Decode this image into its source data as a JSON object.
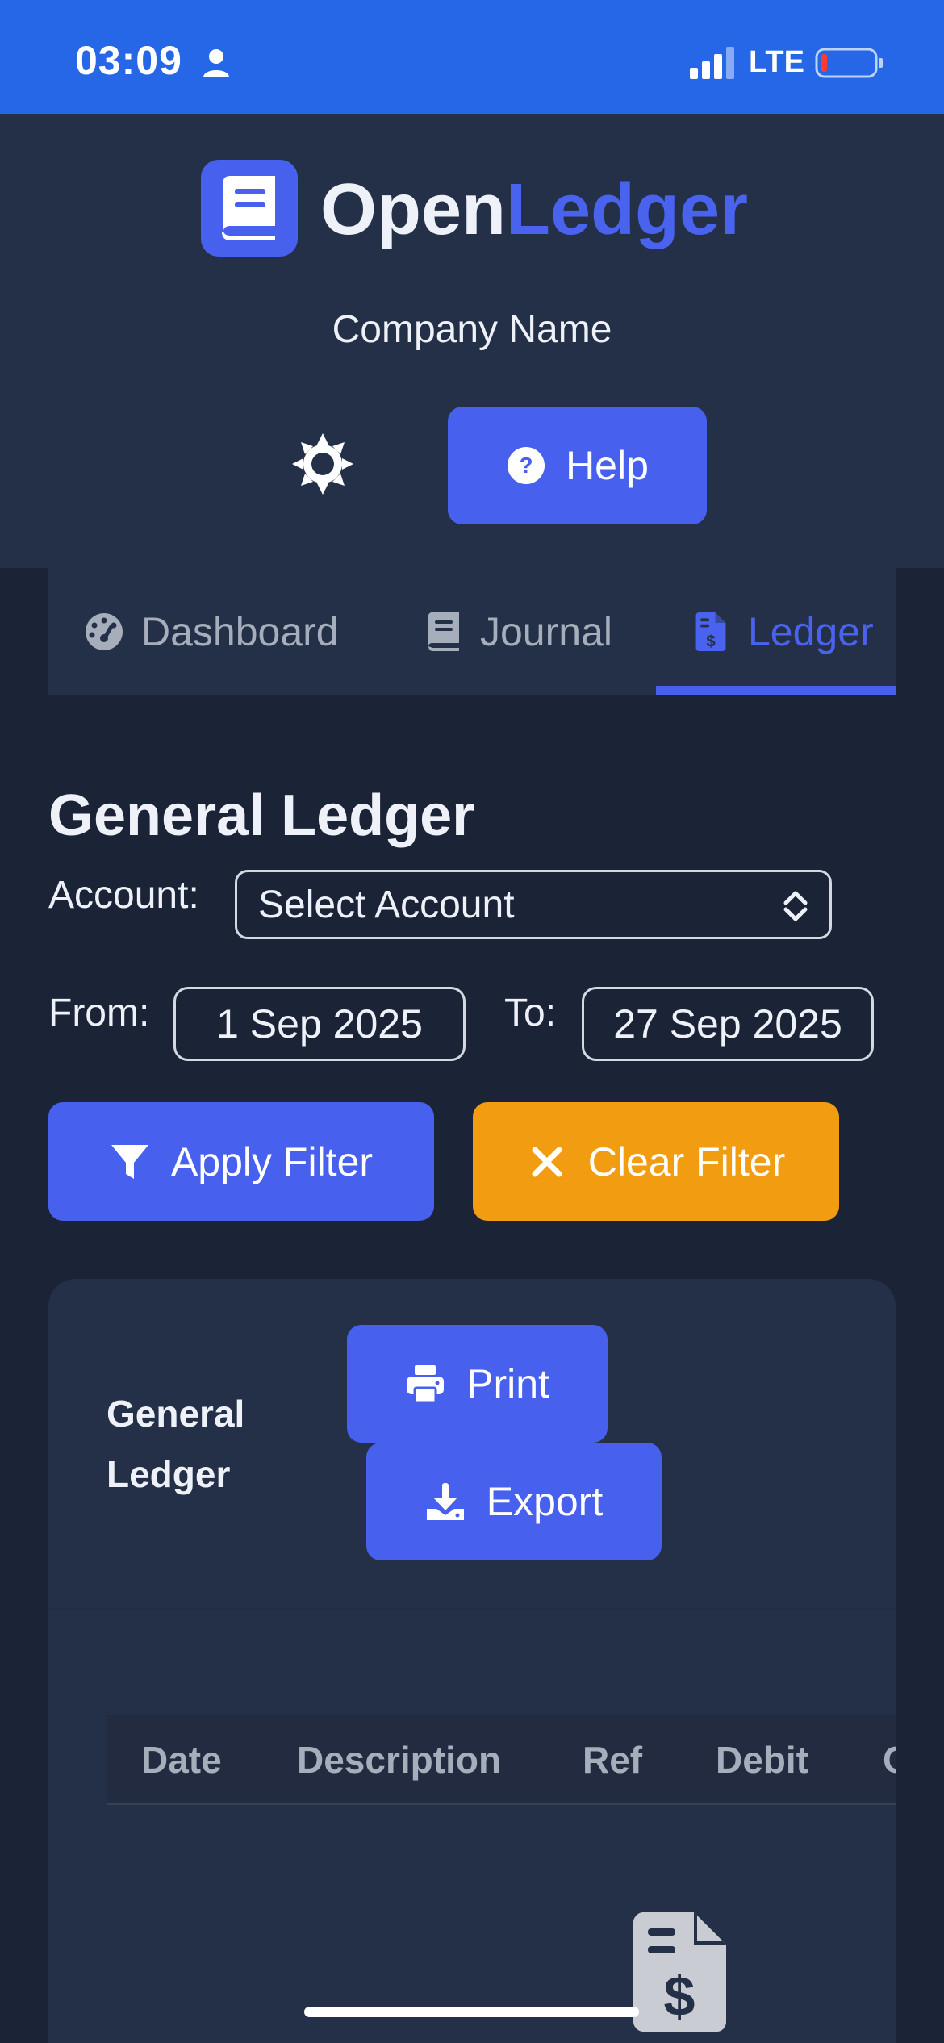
{
  "status_bar": {
    "time": "03:09",
    "network": "LTE"
  },
  "brand": {
    "part1": "Open",
    "part2": "Ledger",
    "company": "Company Name"
  },
  "header": {
    "help_label": "Help"
  },
  "nav": {
    "tabs": [
      {
        "label": "Dashboard"
      },
      {
        "label": "Journal"
      },
      {
        "label": "Ledger",
        "active": true
      }
    ]
  },
  "page": {
    "title": "General Ledger"
  },
  "filters": {
    "account_label": "Account:",
    "account_value": "Select Account",
    "from_label": "From:",
    "from_value": "1 Sep 2025",
    "to_label": "To:",
    "to_value": "27 Sep 2025",
    "apply_label": "Apply Filter",
    "clear_label": "Clear Filter"
  },
  "card": {
    "title": "General Ledger",
    "print_label": "Print",
    "export_label": "Export",
    "columns": [
      "Date",
      "Description",
      "Ref",
      "Debit",
      "Credit"
    ]
  },
  "colors": {
    "accent": "#4760ee",
    "warning": "#f29c11",
    "status_bar": "#2667e8",
    "background": "#1b2336",
    "surface": "#243048"
  },
  "icons": [
    "person-icon",
    "signal-icon",
    "battery-icon",
    "book-icon",
    "gear-icon",
    "help-circle-icon",
    "dashboard-gauge-icon",
    "journal-book-icon",
    "ledger-invoice-icon",
    "chevron-updown-icon",
    "filter-icon",
    "close-icon",
    "printer-icon",
    "download-icon",
    "empty-invoice-icon"
  ]
}
